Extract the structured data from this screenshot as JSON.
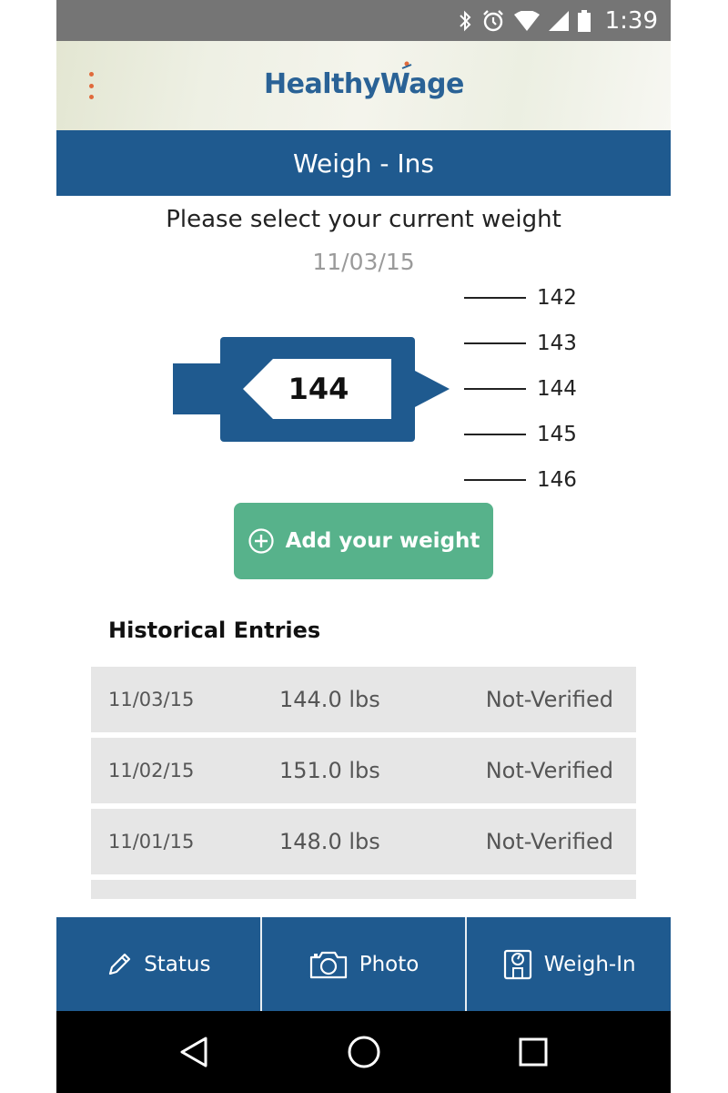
{
  "status_bar": {
    "time": "1:39",
    "icons": [
      "bluetooth-icon",
      "alarm-icon",
      "wifi-icon",
      "signal-icon",
      "battery-icon"
    ]
  },
  "header": {
    "logo_text": "HealthyWage",
    "menu_icon": "more-vert-icon"
  },
  "title_bar": {
    "title": "Weigh - Ins"
  },
  "weigh_in": {
    "prompt": "Please select your current weight",
    "date": "11/03/15",
    "selected_weight": "144",
    "scale_values": [
      "142",
      "143",
      "144",
      "145",
      "146"
    ],
    "add_button_label": "Add your weight",
    "add_icon": "plus-circle-icon"
  },
  "history": {
    "title": "Historical Entries",
    "entries": [
      {
        "date": "11/03/15",
        "weight": "144.0 lbs",
        "status": "Not-Verified"
      },
      {
        "date": "11/02/15",
        "weight": "151.0 lbs",
        "status": "Not-Verified"
      },
      {
        "date": "11/01/15",
        "weight": "148.0 lbs",
        "status": "Not-Verified"
      }
    ]
  },
  "bottom_nav": [
    {
      "label": "Status",
      "icon": "pencil-icon"
    },
    {
      "label": "Photo",
      "icon": "camera-icon"
    },
    {
      "label": "Weigh-In",
      "icon": "scale-icon"
    }
  ],
  "android_nav": {
    "back": "back-icon",
    "home": "home-icon",
    "recents": "recents-icon"
  },
  "colors": {
    "primary": "#1f5a8f",
    "accent_green": "#57b28b",
    "menu_dots": "#e06a3b",
    "row_bg": "#e6e6e6",
    "status_bar": "#757575"
  }
}
